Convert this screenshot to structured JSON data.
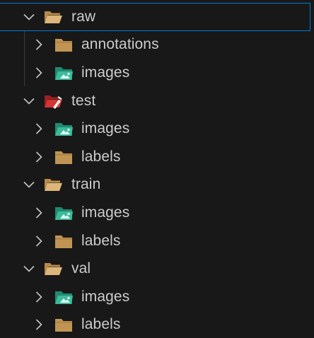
{
  "explorer": {
    "items": [
      {
        "label": "raw",
        "level": 0,
        "expanded": true,
        "icon": "folder-open-icon",
        "selected": true
      },
      {
        "label": "annotations",
        "level": 1,
        "expanded": false,
        "icon": "folder-icon"
      },
      {
        "label": "images",
        "level": 1,
        "expanded": false,
        "icon": "folder-images-icon"
      },
      {
        "label": "test",
        "level": 0,
        "expanded": true,
        "icon": "folder-test-icon"
      },
      {
        "label": "images",
        "level": 1,
        "expanded": false,
        "icon": "folder-images-icon"
      },
      {
        "label": "labels",
        "level": 1,
        "expanded": false,
        "icon": "folder-icon"
      },
      {
        "label": "train",
        "level": 0,
        "expanded": true,
        "icon": "folder-open-icon"
      },
      {
        "label": "images",
        "level": 1,
        "expanded": false,
        "icon": "folder-images-icon"
      },
      {
        "label": "labels",
        "level": 1,
        "expanded": false,
        "icon": "folder-icon"
      },
      {
        "label": "val",
        "level": 0,
        "expanded": true,
        "icon": "folder-open-icon"
      },
      {
        "label": "images",
        "level": 1,
        "expanded": false,
        "icon": "folder-images-icon"
      },
      {
        "label": "labels",
        "level": 1,
        "expanded": false,
        "icon": "folder-icon"
      }
    ]
  },
  "colors": {
    "background": "#181818",
    "selection_border": "#0078d4",
    "folder": "#c09553",
    "images_folder": "#2fa98c",
    "test_folder": "#c62828",
    "text": "#cccccc"
  }
}
